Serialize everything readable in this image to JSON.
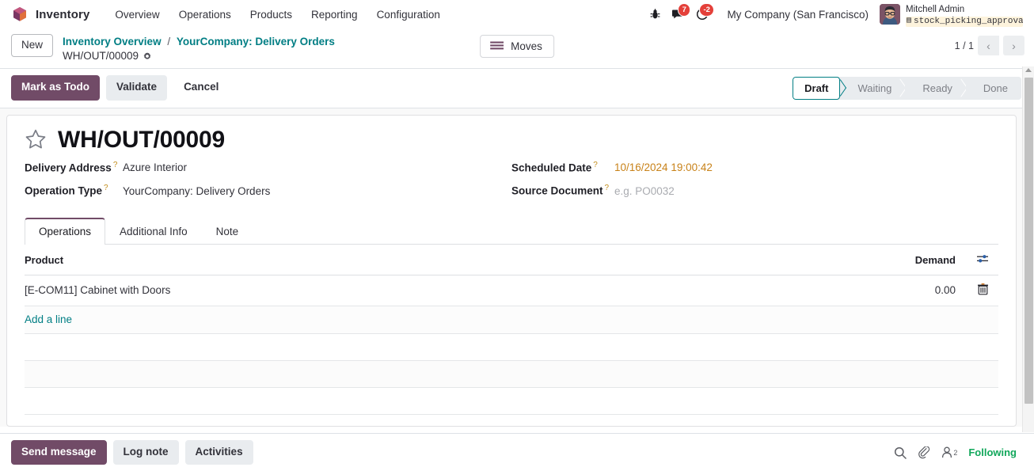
{
  "navbar": {
    "brand": "Inventory",
    "menu": [
      {
        "label": "Overview"
      },
      {
        "label": "Operations"
      },
      {
        "label": "Products"
      },
      {
        "label": "Reporting"
      },
      {
        "label": "Configuration"
      }
    ],
    "icons": {
      "bug": "bug-icon",
      "messages": {
        "name": "messages-icon",
        "badge": "7"
      },
      "activities": {
        "name": "activities-clock-icon",
        "badge": "-2"
      }
    },
    "company": "My Company (San Francisco)",
    "user": {
      "name": "Mitchell Admin",
      "database": "stock_picking_approvals-…"
    }
  },
  "control_panel": {
    "new_label": "New",
    "breadcrumb": {
      "root": "Inventory Overview",
      "separator": "/",
      "parent": "YourCompany: Delivery Orders",
      "record": "WH/OUT/00009"
    },
    "moves_label": "Moves",
    "pager": {
      "text": "1 / 1",
      "prev": "‹",
      "next": "›"
    }
  },
  "action_bar": {
    "buttons": [
      {
        "label": "Mark as Todo",
        "style": "primary"
      },
      {
        "label": "Validate",
        "style": "secondary"
      },
      {
        "label": "Cancel",
        "style": "ghost"
      }
    ],
    "statusbar": [
      {
        "label": "Draft",
        "active": true
      },
      {
        "label": "Waiting",
        "active": false
      },
      {
        "label": "Ready",
        "active": false
      },
      {
        "label": "Done",
        "active": false
      }
    ]
  },
  "record": {
    "title": "WH/OUT/00009",
    "fields_left": [
      {
        "label": "Delivery Address",
        "value": "Azure Interior",
        "type": "link"
      },
      {
        "label": "Operation Type",
        "value": "YourCompany: Delivery Orders",
        "type": "link"
      }
    ],
    "fields_right": [
      {
        "label": "Scheduled Date",
        "value": "10/16/2024 19:00:42",
        "type": "date"
      },
      {
        "label": "Source Document",
        "value": "e.g. PO0032",
        "type": "placeholder"
      }
    ],
    "help_marker": "?"
  },
  "notebook": {
    "tabs": [
      {
        "label": "Operations",
        "active": true
      },
      {
        "label": "Additional Info",
        "active": false
      },
      {
        "label": "Note",
        "active": false
      }
    ],
    "table": {
      "columns": [
        "Product",
        "Demand"
      ],
      "rows": [
        {
          "product": "[E-COM11] Cabinet with Doors",
          "demand": "0.00"
        }
      ],
      "add_line_label": "Add a line"
    }
  },
  "chatter": {
    "buttons": [
      {
        "label": "Send message",
        "style": "primary"
      },
      {
        "label": "Log note",
        "style": "secondary"
      },
      {
        "label": "Activities",
        "style": "secondary"
      }
    ],
    "followers_count": "2",
    "following_label": "Following"
  },
  "colors": {
    "brand_purple": "#714b67",
    "link_teal": "#017e84",
    "date_orange": "#c88219",
    "badge_red": "#e4403a",
    "following_green": "#11a75b"
  }
}
